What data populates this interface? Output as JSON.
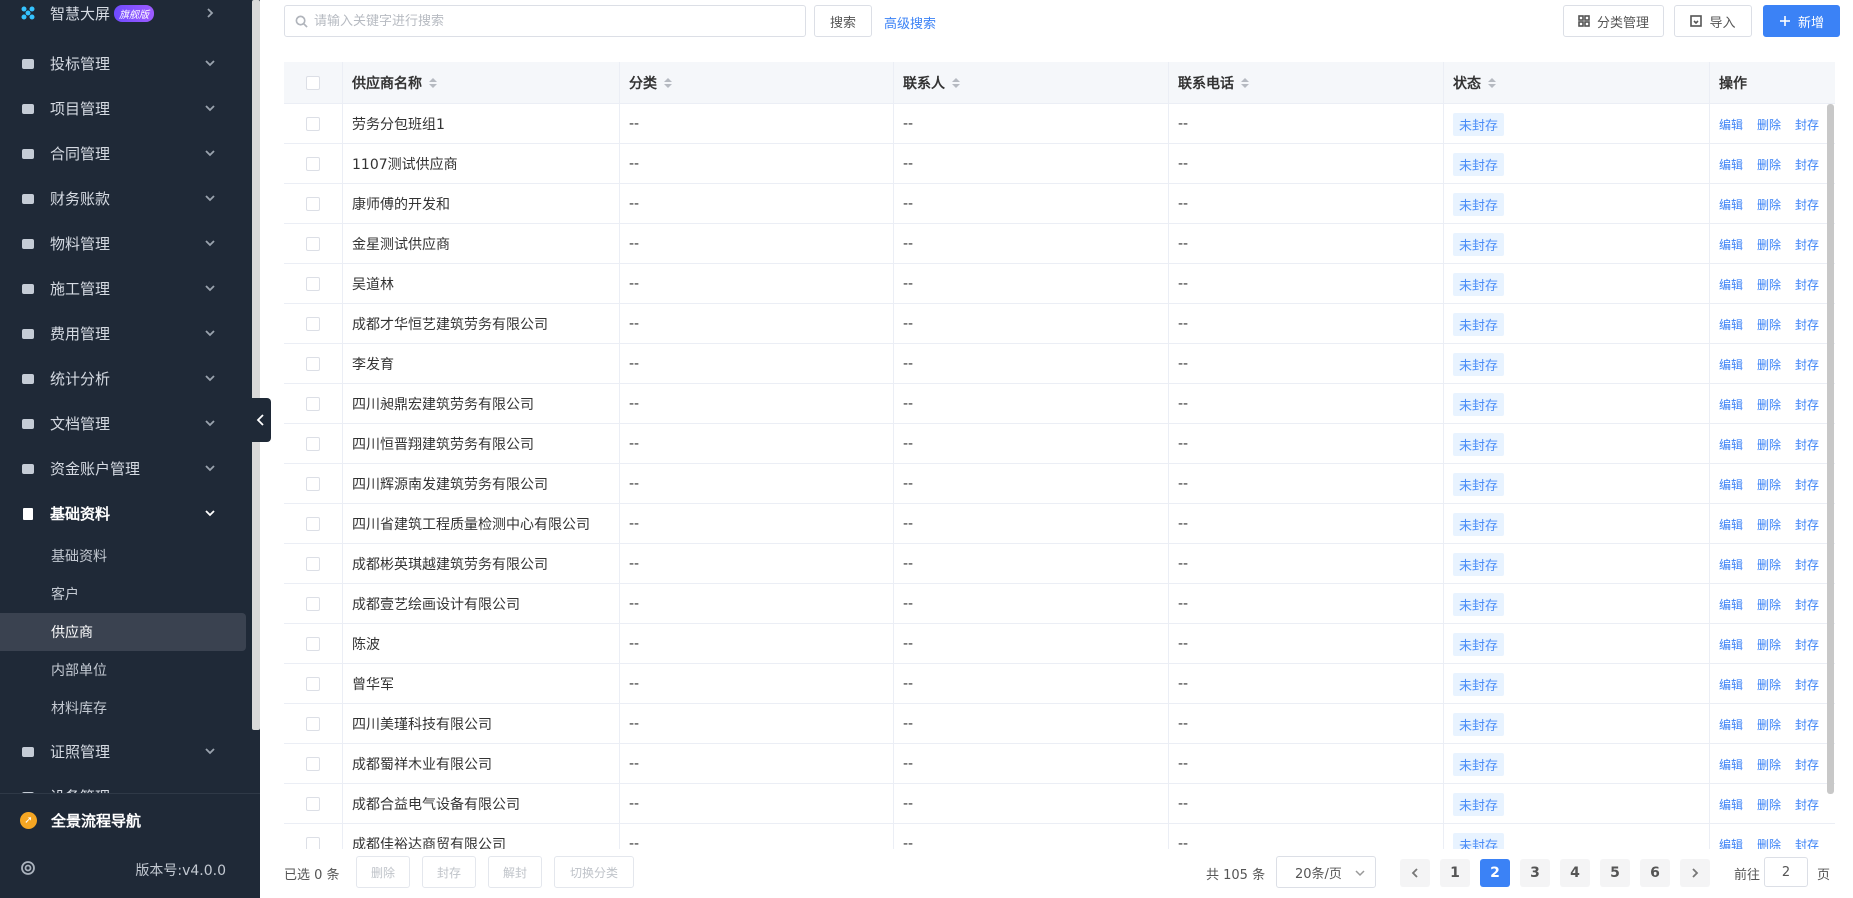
{
  "sidebar": {
    "top_item": {
      "label": "智慧大屏",
      "badge": "旗舰版"
    },
    "groups": [
      {
        "label": "投标管理",
        "icon": "gavel-icon"
      },
      {
        "label": "项目管理",
        "icon": "building-icon"
      },
      {
        "label": "合同管理",
        "icon": "user-icon"
      },
      {
        "label": "财务账款",
        "icon": "money-bag-icon"
      },
      {
        "label": "物料管理",
        "icon": "warehouse-icon"
      },
      {
        "label": "施工管理",
        "icon": "tools-icon"
      },
      {
        "label": "费用管理",
        "icon": "shield-icon"
      },
      {
        "label": "统计分析",
        "icon": "chart-icon"
      },
      {
        "label": "文档管理",
        "icon": "folder-icon"
      },
      {
        "label": "资金账户管理",
        "icon": "card-icon"
      }
    ],
    "active_group": {
      "label": "基础资料",
      "icon": "book-icon"
    },
    "sub_items": [
      "基础资料",
      "客户",
      "供应商",
      "内部单位",
      "材料库存"
    ],
    "active_sub": "供应商",
    "after_groups": [
      {
        "label": "证照管理",
        "icon": "id-card-icon"
      },
      {
        "label": "设备管理",
        "icon": "pin-icon"
      }
    ],
    "footer": {
      "nav_label": "全景流程导航",
      "version": "版本号:v4.0.0"
    }
  },
  "toolbar": {
    "search_placeholder": "请输入关键字进行搜索",
    "search_button": "搜索",
    "advanced_search": "高级搜索",
    "category_button": "分类管理",
    "import_button": "导入",
    "add_button": "新增"
  },
  "table": {
    "columns": [
      "供应商名称",
      "分类",
      "联系人",
      "联系电话",
      "状态",
      "操作"
    ],
    "rows": [
      {
        "name": "劳务分包班组1",
        "category": "--",
        "contact": "--",
        "phone": "--",
        "status": "未封存"
      },
      {
        "name": "1107测试供应商",
        "category": "--",
        "contact": "--",
        "phone": "--",
        "status": "未封存"
      },
      {
        "name": "康师傅的开发和",
        "category": "--",
        "contact": "--",
        "phone": "--",
        "status": "未封存"
      },
      {
        "name": "金星测试供应商",
        "category": "--",
        "contact": "--",
        "phone": "--",
        "status": "未封存"
      },
      {
        "name": "吴道林",
        "category": "--",
        "contact": "--",
        "phone": "--",
        "status": "未封存"
      },
      {
        "name": "成都才华恒艺建筑劳务有限公司",
        "category": "--",
        "contact": "--",
        "phone": "--",
        "status": "未封存"
      },
      {
        "name": "李发育",
        "category": "--",
        "contact": "--",
        "phone": "--",
        "status": "未封存"
      },
      {
        "name": "四川昶鼎宏建筑劳务有限公司",
        "category": "--",
        "contact": "--",
        "phone": "--",
        "status": "未封存"
      },
      {
        "name": "四川恒晋翔建筑劳务有限公司",
        "category": "--",
        "contact": "--",
        "phone": "--",
        "status": "未封存"
      },
      {
        "name": "四川辉源南发建筑劳务有限公司",
        "category": "--",
        "contact": "--",
        "phone": "--",
        "status": "未封存"
      },
      {
        "name": "四川省建筑工程质量检测中心有限公司",
        "category": "--",
        "contact": "--",
        "phone": "--",
        "status": "未封存"
      },
      {
        "name": "成都彬英琪越建筑劳务有限公司",
        "category": "--",
        "contact": "--",
        "phone": "--",
        "status": "未封存"
      },
      {
        "name": "成都壹艺绘画设计有限公司",
        "category": "--",
        "contact": "--",
        "phone": "--",
        "status": "未封存"
      },
      {
        "name": "陈波",
        "category": "--",
        "contact": "--",
        "phone": "--",
        "status": "未封存"
      },
      {
        "name": "曾华军",
        "category": "--",
        "contact": "--",
        "phone": "--",
        "status": "未封存"
      },
      {
        "name": "四川美瑾科技有限公司",
        "category": "--",
        "contact": "--",
        "phone": "--",
        "status": "未封存"
      },
      {
        "name": "成都蜀祥木业有限公司",
        "category": "--",
        "contact": "--",
        "phone": "--",
        "status": "未封存"
      },
      {
        "name": "成都合益电气设备有限公司",
        "category": "--",
        "contact": "--",
        "phone": "--",
        "status": "未封存"
      },
      {
        "name": "成都佳裕达商贸有限公司",
        "category": "--",
        "contact": "--",
        "phone": "--",
        "status": "未封存"
      }
    ],
    "actions": [
      "编辑",
      "删除",
      "封存"
    ]
  },
  "footer": {
    "selected": "已选 0 条",
    "batch_buttons": [
      "删除",
      "封存",
      "解封",
      "切换分类"
    ],
    "total": "共 105 条",
    "page_size": "20条/页",
    "pages": [
      "1",
      "2",
      "3",
      "4",
      "5",
      "6"
    ],
    "current_page": "2",
    "goto_prefix": "前往",
    "goto_value": "2",
    "goto_suffix": "页"
  },
  "colors": {
    "primary": "#3b82f6",
    "sidebar_bg": "#1f2937",
    "status_bg": "#e8f3ff"
  }
}
